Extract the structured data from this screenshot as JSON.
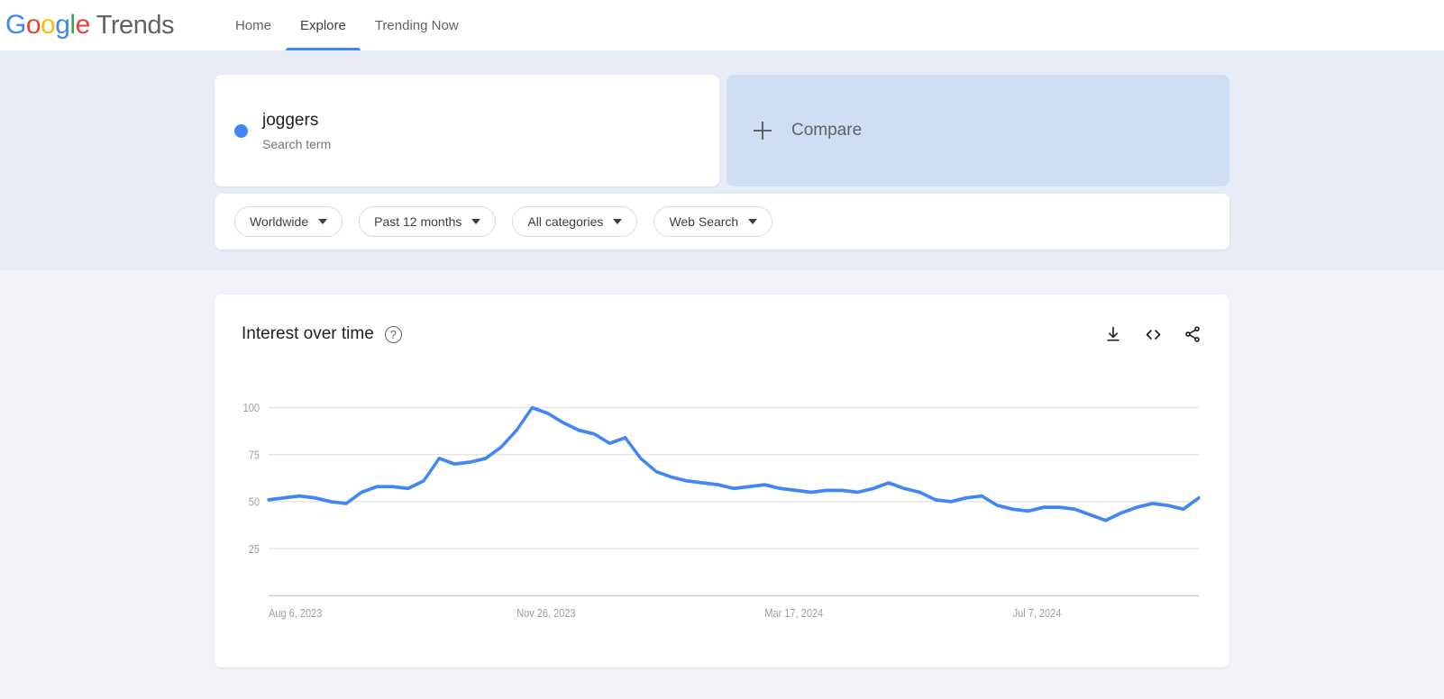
{
  "header": {
    "logo": {
      "google": "Google",
      "trends": "Trends"
    },
    "nav": [
      {
        "label": "Home",
        "active": false
      },
      {
        "label": "Explore",
        "active": true
      },
      {
        "label": "Trending Now",
        "active": false
      }
    ]
  },
  "search": {
    "term": {
      "title": "joggers",
      "subtitle": "Search term",
      "color": "#4285F4"
    },
    "compare": {
      "label": "Compare",
      "icon": "plus-icon"
    },
    "filters": [
      {
        "name": "location",
        "label": "Worldwide"
      },
      {
        "name": "time-range",
        "label": "Past 12 months"
      },
      {
        "name": "category",
        "label": "All categories"
      },
      {
        "name": "search-type",
        "label": "Web Search"
      }
    ]
  },
  "chart_panel": {
    "title": "Interest over time",
    "help_icon": "?",
    "actions": [
      {
        "name": "download-icon",
        "label": "Download"
      },
      {
        "name": "embed-code-icon",
        "label": "Embed"
      },
      {
        "name": "share-icon",
        "label": "Share"
      }
    ]
  },
  "chart_data": {
    "type": "line",
    "title": "Interest over time",
    "xlabel": "",
    "ylabel": "",
    "ylim": [
      0,
      105
    ],
    "yticks": [
      25,
      50,
      75,
      100
    ],
    "grid": true,
    "legend": false,
    "line_color": "#4285F4",
    "xticks": [
      "Aug 6, 2023",
      "Nov 26, 2023",
      "Mar 17, 2024",
      "Jul 7, 2024"
    ],
    "xtick_indices": [
      0,
      16,
      32,
      48
    ],
    "series": [
      {
        "name": "joggers",
        "color": "#4285F4",
        "values": [
          51,
          52,
          53,
          52,
          50,
          49,
          55,
          58,
          58,
          57,
          61,
          73,
          70,
          71,
          73,
          79,
          88,
          100,
          97,
          92,
          88,
          86,
          81,
          84,
          73,
          66,
          63,
          61,
          60,
          59,
          57,
          58,
          59,
          57,
          56,
          55,
          56,
          56,
          55,
          57,
          60,
          57,
          55,
          51,
          50,
          52,
          53,
          48,
          46,
          45,
          47,
          47,
          46,
          43,
          40,
          44,
          47,
          49,
          48,
          46,
          52
        ]
      }
    ]
  }
}
